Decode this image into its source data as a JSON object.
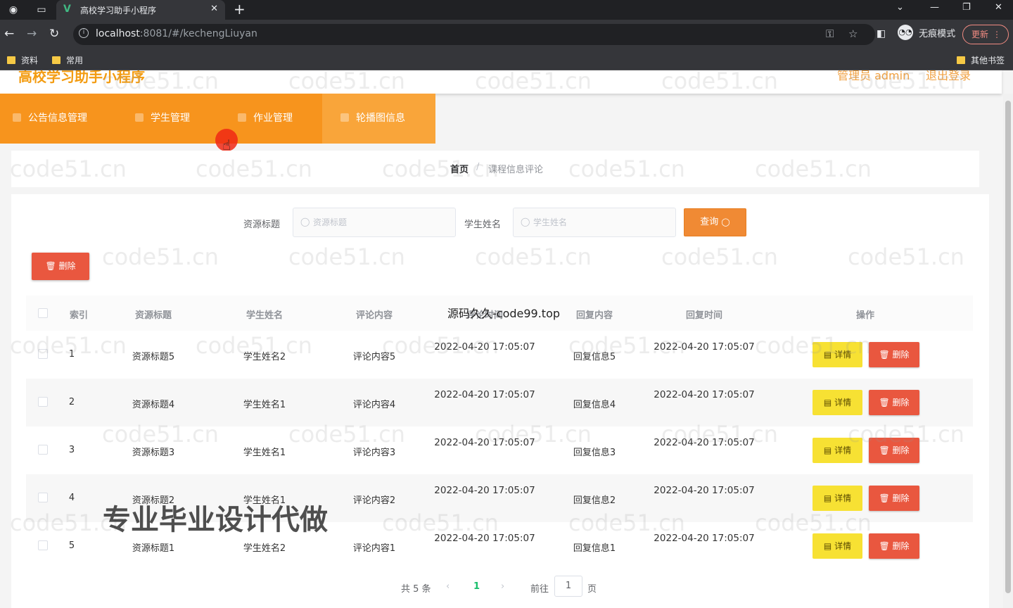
{
  "browser": {
    "tab_title": "高校学习助手小程序",
    "url_host": "localhost",
    "url_rest": ":8081/#/kechengLiuyan",
    "incognito_label": "无痕模式",
    "update_label": "更新",
    "bookmarks": [
      "资料",
      "常用"
    ],
    "other_bookmarks": "其他书签"
  },
  "header": {
    "site_title": "高校学习助手小程序",
    "user_label": "管理员 admin",
    "logout_label": "退出登录"
  },
  "menu": [
    {
      "label": "公告信息管理",
      "active": false
    },
    {
      "label": "学生管理",
      "active": false
    },
    {
      "label": "作业管理",
      "active": false
    },
    {
      "label": "轮播图信息",
      "active": true
    }
  ],
  "breadcrumb": {
    "home": "首页",
    "separator": "/",
    "current": "课程信息评论"
  },
  "search": {
    "resource_title_label": "资源标题",
    "resource_title_placeholder": "资源标题",
    "student_name_label": "学生姓名",
    "student_name_placeholder": "学生姓名",
    "query_label": "查询"
  },
  "actions": {
    "bulk_delete_label": "删除"
  },
  "table": {
    "headers": [
      "索引",
      "资源标题",
      "学生姓名",
      "评论内容",
      "评论时间",
      "回复内容",
      "回复时间",
      "操作"
    ],
    "rows": [
      {
        "index": "1",
        "resource_title": "资源标题5",
        "student_name": "学生姓名2",
        "comment": "评论内容5",
        "comment_time": "2022-04-20 17:05:07",
        "reply": "回复信息5",
        "reply_time": "2022-04-20 17:05:07"
      },
      {
        "index": "2",
        "resource_title": "资源标题4",
        "student_name": "学生姓名1",
        "comment": "评论内容4",
        "comment_time": "2022-04-20 17:05:07",
        "reply": "回复信息4",
        "reply_time": "2022-04-20 17:05:07"
      },
      {
        "index": "3",
        "resource_title": "资源标题3",
        "student_name": "学生姓名1",
        "comment": "评论内容3",
        "comment_time": "2022-04-20 17:05:07",
        "reply": "回复信息3",
        "reply_time": "2022-04-20 17:05:07"
      },
      {
        "index": "4",
        "resource_title": "资源标题2",
        "student_name": "学生姓名1",
        "comment": "评论内容2",
        "comment_time": "2022-04-20 17:05:07",
        "reply": "回复信息2",
        "reply_time": "2022-04-20 17:05:07"
      },
      {
        "index": "5",
        "resource_title": "资源标题1",
        "student_name": "学生姓名2",
        "comment": "评论内容1",
        "comment_time": "2022-04-20 17:05:07",
        "reply": "回复信息1",
        "reply_time": "2022-04-20 17:05:07"
      }
    ],
    "detail_label": "详情",
    "delete_label": "删除"
  },
  "pagination": {
    "total": "共 5 条",
    "current_page": "1",
    "goto_prefix": "前往",
    "goto_value": "1",
    "goto_suffix": "页"
  },
  "overlays": {
    "watermark": "code51.cn",
    "top_caption": "源码久久-code99.top",
    "big_caption": "专业毕业设计代做"
  },
  "colors": {
    "menu_bg": "#f7941d",
    "query_button": "#f08a34",
    "delete_button": "#e9573f",
    "detail_button": "#f7e133",
    "pager_active": "#19be6b"
  }
}
